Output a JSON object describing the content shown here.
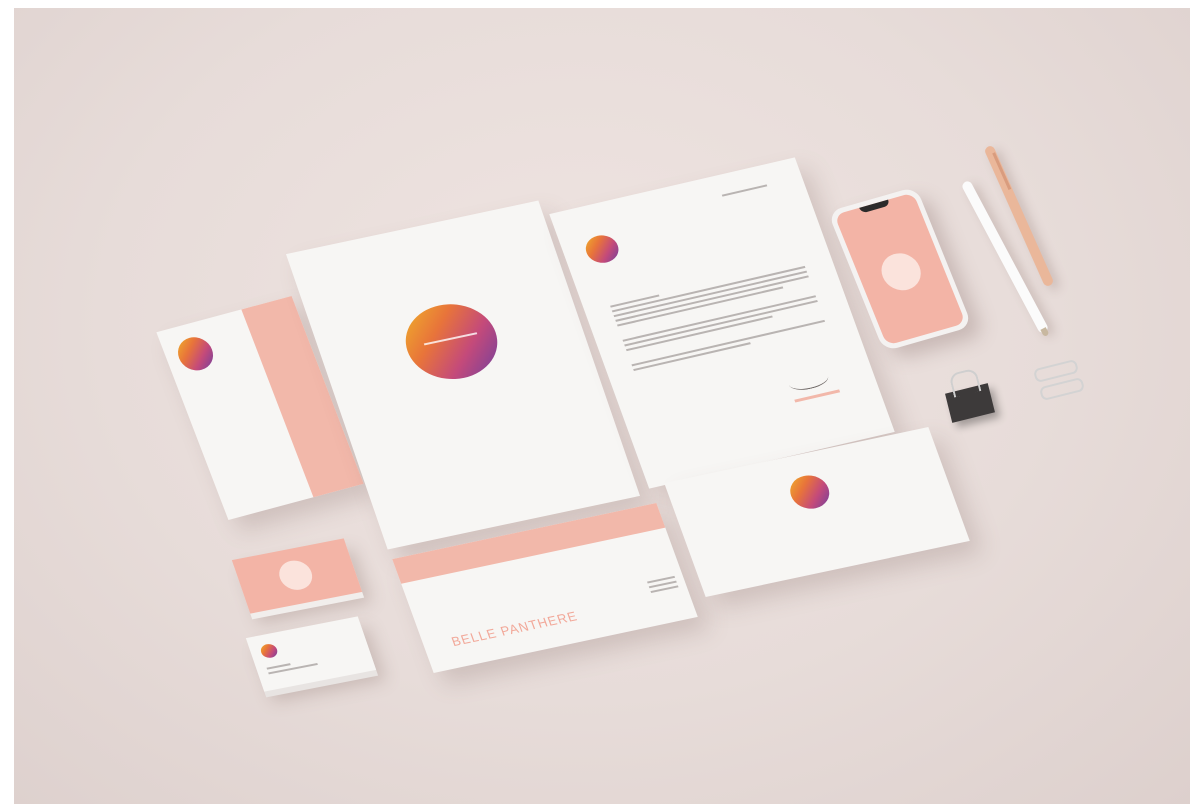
{
  "brand": {
    "name": "BELLE PANTHERE",
    "accent": "#f2b8aa",
    "orb_gradient": [
      "#f0b429",
      "#e8743a",
      "#c44a7a",
      "#6b3fa0"
    ],
    "background": "#e9dedb"
  }
}
